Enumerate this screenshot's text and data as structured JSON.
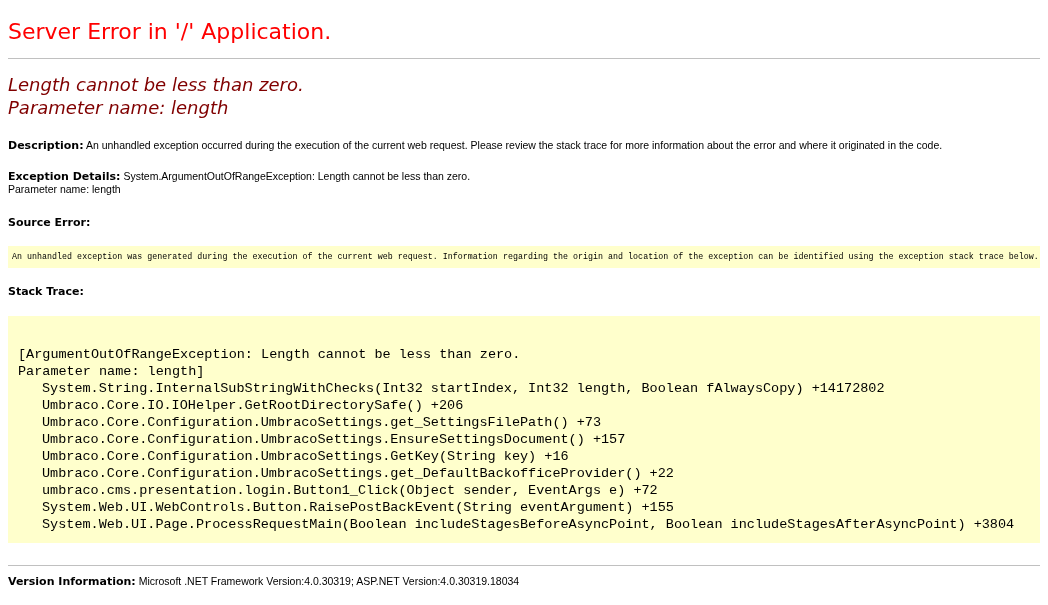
{
  "title": "Server Error in '/' Application.",
  "error_heading": [
    "Length cannot be less than zero.",
    "Parameter name: length"
  ],
  "description": "**Description:** An unhandled exception occurred during the execution of the current web request. Please review the stack trace for more information about the error and where it originated in the code.",
  "exception_details": [
    "**Exception Details:** System.ArgumentOutOfRangeException: Length cannot be less than zero.",
    "Parameter name: length"
  ],
  "source_error": {
    "label": "Source Error:",
    "message": "An unhandled exception was generated during the execution of the current web request. Information regarding the origin and location of the exception can be identified using the exception stack trace below."
  },
  "stack_trace": {
    "label": "Stack Trace:",
    "header": [
      "[ArgumentOutOfRangeException: Length cannot be less than zero.",
      "Parameter name: length]"
    ],
    "frames": [
      "System.String.InternalSubStringWithChecks(Int32 startIndex, Int32 length, Boolean fAlwaysCopy) +14172802",
      "Umbraco.Core.IO.IOHelper.GetRootDirectorySafe() +206",
      "Umbraco.Core.Configuration.UmbracoSettings.get_SettingsFilePath() +73",
      "Umbraco.Core.Configuration.UmbracoSettings.EnsureSettingsDocument() +157",
      "Umbraco.Core.Configuration.UmbracoSettings.GetKey(String key) +16",
      "Umbraco.Core.Configuration.UmbracoSettings.get_DefaultBackofficeProvider() +22",
      "umbraco.cms.presentation.login.Button1_Click(Object sender, EventArgs e) +72",
      "System.Web.UI.WebControls.Button.RaisePostBackEvent(String eventArgument) +155",
      "System.Web.UI.Page.ProcessRequestMain(Boolean includeStagesBeforeAsyncPoint, Boolean includeStagesAfterAsyncPoint) +3804"
    ]
  },
  "version_info": "**Version Information:** Microsoft .NET Framework Version:4.0.30319; ASP.NET Version:4.0.30319.18034"
}
